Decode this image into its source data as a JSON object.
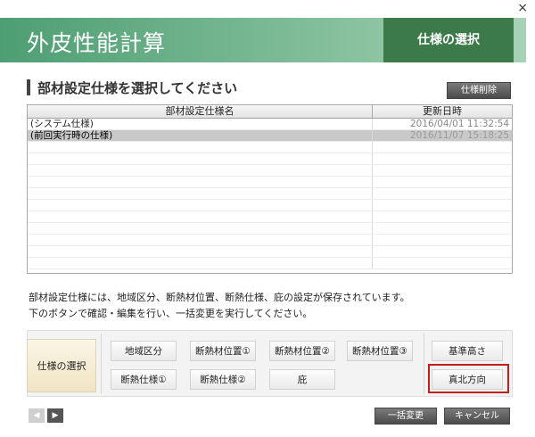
{
  "window": {
    "close_glyph": "×"
  },
  "header": {
    "title": "外皮性能計算",
    "tab_label": "仕様の選択"
  },
  "section": {
    "title": "部材設定仕様を選択してください",
    "delete_button": "仕様削除"
  },
  "list": {
    "columns": [
      "部材設定仕様名",
      "更新日時"
    ],
    "rows": [
      {
        "name": "(システム仕様)",
        "date": "2016/04/01 11:32:54",
        "selected": false
      },
      {
        "name": "(前回実行時の仕様)",
        "date": "2016/11/07 15:18:25",
        "selected": true
      }
    ]
  },
  "description": {
    "line1": "部材設定仕様には、地域区分、断熱材位置、断熱仕様、庇の設定が保存されています。",
    "line2": "下のボタンで確認・編集を行い、一括変更を実行してください。"
  },
  "panel": {
    "spec_select": "仕様の選択",
    "buttons": [
      "地域区分",
      "断熱材位置①",
      "断熱材位置②",
      "断熱材位置③",
      "断熱仕様①",
      "断熱仕様②",
      "庇"
    ],
    "right_buttons": [
      "基準高さ",
      "真北方向"
    ]
  },
  "footer": {
    "prev": "◀",
    "next": "▶",
    "bulk_change": "一括変更",
    "cancel": "キャンセル"
  },
  "colors": {
    "header_dark": "#3c7a49",
    "highlight": "#c21e1e"
  }
}
